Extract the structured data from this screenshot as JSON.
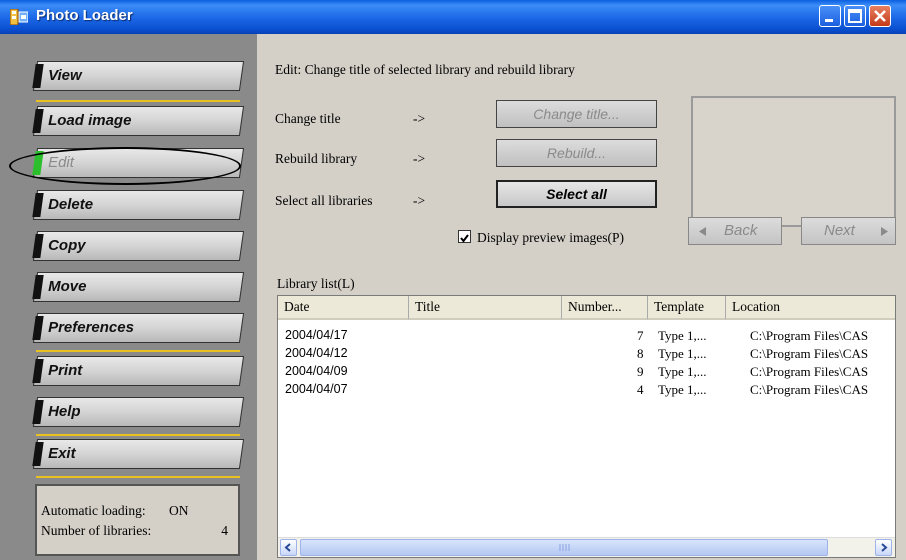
{
  "window": {
    "title": "Photo Loader"
  },
  "sidebar": {
    "items": [
      {
        "label": "View"
      },
      {
        "label": "Load image"
      },
      {
        "label": "Edit"
      },
      {
        "label": "Delete"
      },
      {
        "label": "Copy"
      },
      {
        "label": "Move"
      },
      {
        "label": "Preferences"
      },
      {
        "label": "Print"
      },
      {
        "label": "Help"
      },
      {
        "label": "Exit"
      }
    ],
    "status": {
      "auto_loading_label": "Automatic loading:",
      "auto_loading_value": "ON",
      "num_libraries_label": "Number of libraries:",
      "num_libraries_value": "4"
    }
  },
  "main": {
    "heading": "Edit: Change title of selected library and rebuild library",
    "rows": [
      {
        "label": "Change title",
        "arrow": "->",
        "button": "Change title..."
      },
      {
        "label": "Rebuild library",
        "arrow": "->",
        "button": "Rebuild..."
      },
      {
        "label": "Select all libraries",
        "arrow": "->",
        "button": "Select all"
      }
    ],
    "display_preview_label": "Display preview images(P)",
    "display_preview_checked": true,
    "back_label": "Back",
    "next_label": "Next",
    "library_list_label": "Library list(L)",
    "columns": [
      "Date",
      "Title",
      "Number...",
      "Template",
      "Location"
    ],
    "rows_data": [
      {
        "date": "2004/04/17",
        "title": "",
        "number": "7",
        "template": "Type 1,...",
        "location": "C:\\Program Files\\CAS"
      },
      {
        "date": "2004/04/12",
        "title": "",
        "number": "8",
        "template": "Type 1,...",
        "location": "C:\\Program Files\\CAS"
      },
      {
        "date": "2004/04/09",
        "title": "",
        "number": "9",
        "template": "Type 1,...",
        "location": "C:\\Program Files\\CAS"
      },
      {
        "date": "2004/04/07",
        "title": "",
        "number": "4",
        "template": "Type 1,...",
        "location": "C:\\Program Files\\CAS"
      }
    ]
  }
}
